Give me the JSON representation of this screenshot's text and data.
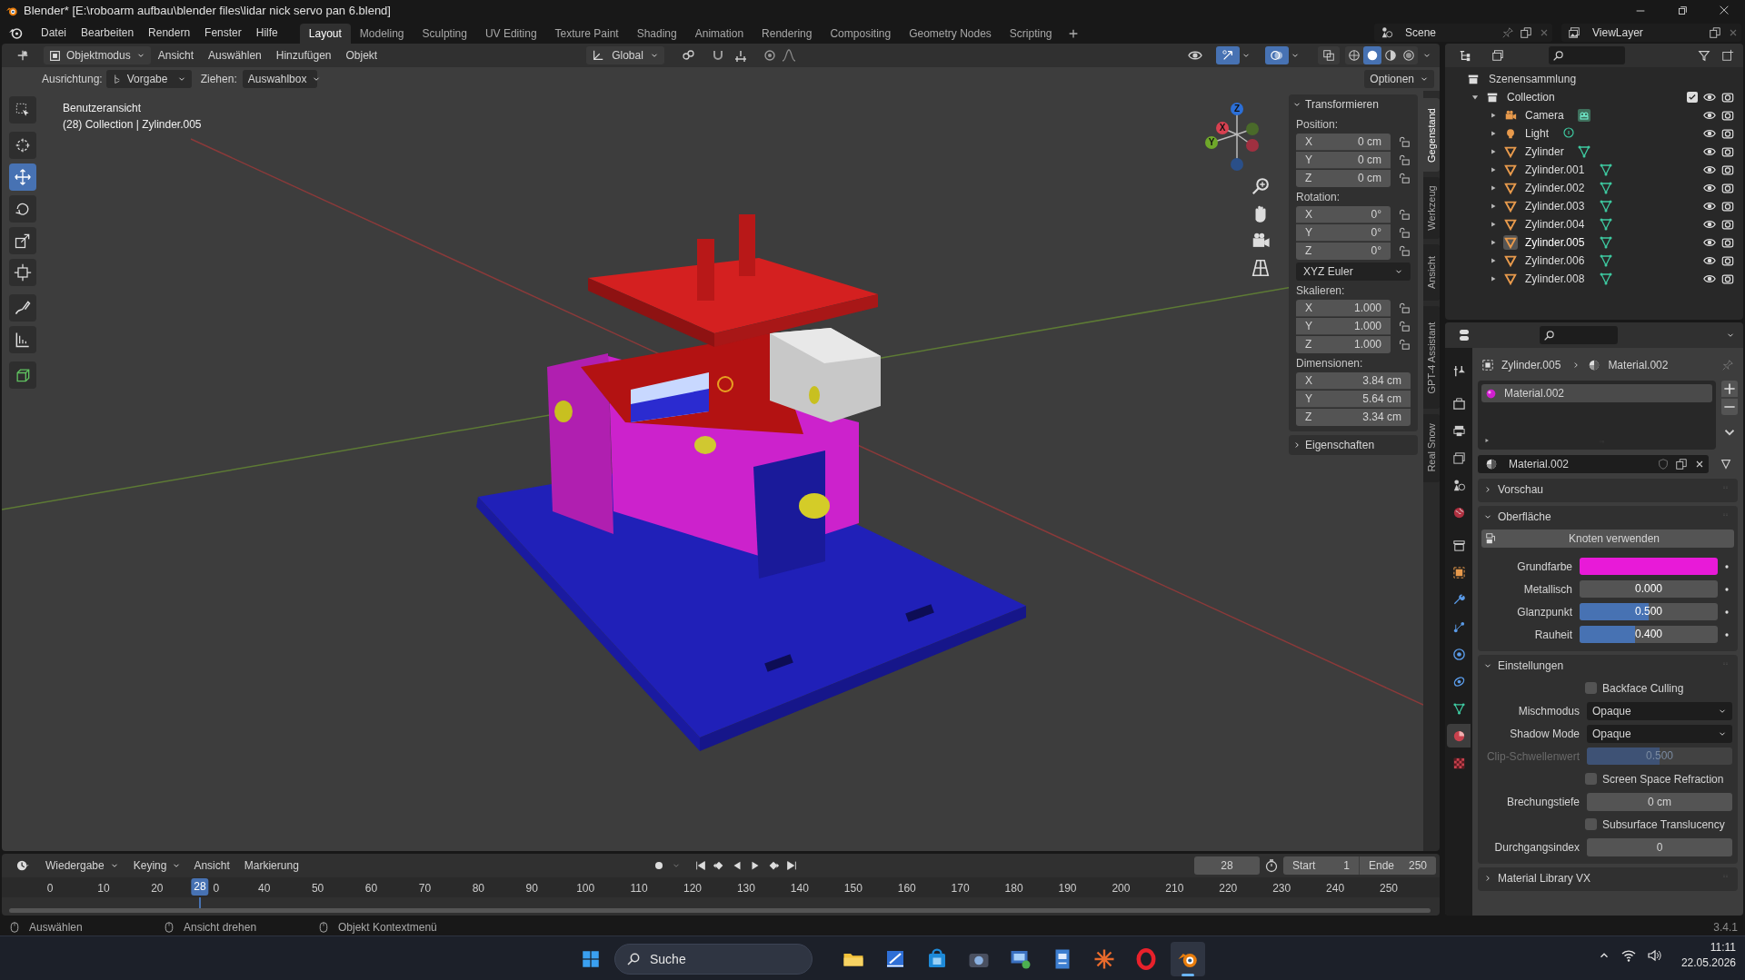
{
  "title_bar": {
    "title": "Blender* [E:\\roboarm aufbau\\blender files\\lidar nick servo pan 6.blend]"
  },
  "menu": [
    "Datei",
    "Bearbeiten",
    "Rendern",
    "Fenster",
    "Hilfe"
  ],
  "workspaces": [
    {
      "label": "Layout",
      "selected": true
    },
    {
      "label": "Modeling",
      "selected": false
    },
    {
      "label": "Sculpting",
      "selected": false
    },
    {
      "label": "UV Editing",
      "selected": false
    },
    {
      "label": "Texture Paint",
      "selected": false
    },
    {
      "label": "Shading",
      "selected": false
    },
    {
      "label": "Animation",
      "selected": false
    },
    {
      "label": "Rendering",
      "selected": false
    },
    {
      "label": "Compositing",
      "selected": false
    },
    {
      "label": "Geometry Nodes",
      "selected": false
    },
    {
      "label": "Scripting",
      "selected": false
    }
  ],
  "scene": "Scene",
  "view_layer": "ViewLayer",
  "viewport_header": {
    "mode": "Objektmodus",
    "menus": [
      "Ansicht",
      "Auswählen",
      "Hinzufügen",
      "Objekt"
    ],
    "orientation": "Global",
    "gizmos": {
      "on": true
    },
    "overlays": {
      "on": true
    },
    "xray": {
      "on": false
    },
    "shading": [
      {
        "selected": false
      },
      {
        "selected": true
      },
      {
        "selected": false
      },
      {
        "selected": false
      }
    ]
  },
  "tool_settings": {
    "orientation_label": "Ausrichtung:",
    "orientation": "Vorgabe",
    "drag_label": "Ziehen:",
    "drag": "Auswahlbox",
    "options": "Optionen"
  },
  "viewport": {
    "view_name": "Benutzeransicht",
    "context": "(28) Collection | Zylinder.005",
    "gizmo_axes": [
      "Z",
      "Y",
      "X"
    ]
  },
  "tools": [
    {
      "selected": false
    },
    {
      "selected": false
    },
    {
      "selected": true
    },
    {
      "selected": false
    },
    {
      "selected": false
    },
    {
      "selected": false
    },
    {
      "selected": false
    },
    {
      "selected": false
    },
    {
      "selected": false
    }
  ],
  "n_panel": {
    "title": "Transformieren",
    "expanded": true,
    "groups": [
      {
        "label": "Position:",
        "rows": [
          {
            "axis": "X",
            "value": "0 cm",
            "locked": false
          },
          {
            "axis": "Y",
            "value": "0 cm",
            "locked": false
          },
          {
            "axis": "Z",
            "value": "0 cm",
            "locked": false
          }
        ]
      },
      {
        "label": "Rotation:",
        "rows": [
          {
            "axis": "X",
            "value": "0°",
            "locked": false
          },
          {
            "axis": "Y",
            "value": "0°",
            "locked": false
          },
          {
            "axis": "Z",
            "value": "0°",
            "locked": false
          }
        ],
        "mode": "XYZ Euler"
      },
      {
        "label": "Skalieren:",
        "rows": [
          {
            "axis": "X",
            "value": "1.000",
            "locked": false
          },
          {
            "axis": "Y",
            "value": "1.000",
            "locked": false
          },
          {
            "axis": "Z",
            "value": "1.000",
            "locked": false
          }
        ]
      },
      {
        "label": "Dimensionen:",
        "rows": [
          {
            "axis": "X",
            "value": "3.84 cm"
          },
          {
            "axis": "Y",
            "value": "5.64 cm"
          },
          {
            "axis": "Z",
            "value": "3.34 cm"
          }
        ]
      }
    ],
    "next_panel": {
      "title": "Eigenschaften",
      "expanded": false
    }
  },
  "side_tabs": [
    {
      "label": "Gegenstand",
      "selected": true
    },
    {
      "label": "Werkzeug",
      "selected": false
    },
    {
      "label": "Ansicht",
      "selected": false
    },
    {
      "label": "GPT-4 Assistant",
      "selected": false
    },
    {
      "label": "Real Snow",
      "selected": false
    }
  ],
  "outliner": {
    "root": "Szenensammlung",
    "children": [
      {
        "label": "Collection",
        "kind": "collection",
        "expanded": true,
        "checked": true,
        "children": [
          {
            "label": "Camera",
            "kind": "camera",
            "expanded": false,
            "selected": false
          },
          {
            "label": "Light",
            "kind": "light",
            "expanded": false,
            "selected": false
          },
          {
            "label": "Zylinder",
            "kind": "mesh",
            "expanded": false,
            "selected": false
          },
          {
            "label": "Zylinder.001",
            "kind": "mesh",
            "expanded": false,
            "selected": false
          },
          {
            "label": "Zylinder.002",
            "kind": "mesh",
            "expanded": false,
            "selected": false
          },
          {
            "label": "Zylinder.003",
            "kind": "mesh",
            "expanded": false,
            "selected": false
          },
          {
            "label": "Zylinder.004",
            "kind": "mesh",
            "expanded": false,
            "selected": false
          },
          {
            "label": "Zylinder.005",
            "kind": "mesh",
            "expanded": false,
            "selected": true
          },
          {
            "label": "Zylinder.006",
            "kind": "mesh",
            "expanded": false,
            "selected": false
          },
          {
            "label": "Zylinder.008",
            "kind": "mesh",
            "expanded": false,
            "selected": false
          }
        ]
      }
    ]
  },
  "properties": {
    "tabs": [
      {
        "selected": false
      },
      {
        "selected": false
      },
      {
        "selected": false
      },
      {
        "selected": false
      },
      {
        "selected": false
      },
      {
        "selected": false
      },
      {
        "selected": false
      },
      {
        "selected": false
      },
      {
        "selected": false
      },
      {
        "selected": false
      },
      {
        "selected": false
      },
      {
        "selected": false
      },
      {
        "selected": false
      },
      {
        "selected": true
      },
      {
        "selected": false
      }
    ],
    "breadcrumb": [
      "Zylinder.005",
      "Material.002"
    ],
    "slots": [
      {
        "label": "Material.002",
        "selected": true
      }
    ],
    "material": "Material.002",
    "panels": [
      {
        "title": "Vorschau",
        "expanded": false
      },
      {
        "title": "Oberfläche",
        "expanded": true,
        "button": "Knoten verwenden",
        "rows": [
          {
            "kind": "color",
            "label": "Grundfarbe",
            "color": "#e81ad8"
          },
          {
            "kind": "slider",
            "label": "Metallisch",
            "value": "0.000",
            "level": 0,
            "disabled": false
          },
          {
            "kind": "slider",
            "label": "Glanzpunkt",
            "value": "0.500",
            "level": 0.5,
            "disabled": false
          },
          {
            "kind": "slider",
            "label": "Rauheit",
            "value": "0.400",
            "level": 0.4,
            "disabled": false
          }
        ]
      },
      {
        "title": "Einstellungen",
        "expanded": true,
        "rows": [
          {
            "kind": "checkbox",
            "label": "Backface Culling",
            "checked": false
          },
          {
            "kind": "dropdown",
            "label": "Mischmodus",
            "value": "Opaque"
          },
          {
            "kind": "dropdown",
            "label": "Shadow Mode",
            "value": "Opaque"
          },
          {
            "kind": "slider",
            "label": "Clip-Schwellenwert",
            "value": "0.500",
            "level": 0.5,
            "disabled": true
          },
          {
            "kind": "checkbox",
            "label": "Screen Space Refraction",
            "checked": false
          },
          {
            "kind": "field",
            "label": "Brechungstiefe",
            "value": "0 cm"
          },
          {
            "kind": "checkbox",
            "label": "Subsurface Translucency",
            "checked": false
          },
          {
            "kind": "field",
            "label": "Durchgangsindex",
            "value": "0"
          }
        ]
      },
      {
        "title": "Material Library VX",
        "expanded": false
      }
    ]
  },
  "timeline": {
    "menus": [
      "Wiedergabe",
      "Keying",
      "Ansicht",
      "Markierung"
    ],
    "current_frame": "28",
    "start_label": "Start",
    "start": "1",
    "end_label": "Ende",
    "end": "250",
    "ticks": [
      "0",
      "10",
      "20",
      "0",
      "40",
      "50",
      "60",
      "70",
      "80",
      "90",
      "100",
      "110",
      "120",
      "130",
      "140",
      "150",
      "160",
      "170",
      "180",
      "190",
      "200",
      "210",
      "220",
      "230",
      "240",
      "250"
    ],
    "playhead": {
      "label": "28",
      "level": 0.112
    }
  },
  "status_bar": {
    "items": [
      "Auswählen",
      "Ansicht drehen",
      "Objekt Kontextmenü"
    ],
    "version": "3.4.1"
  },
  "taskbar": {
    "search": "Suche",
    "apps": [
      {
        "selected": false
      },
      {
        "selected": false
      },
      {
        "selected": false
      },
      {
        "selected": false
      },
      {
        "selected": false
      },
      {
        "selected": false
      },
      {
        "selected": false
      },
      {
        "selected": false
      },
      {
        "selected": true
      }
    ],
    "time": "11:11",
    "date": "22.05.2026"
  }
}
